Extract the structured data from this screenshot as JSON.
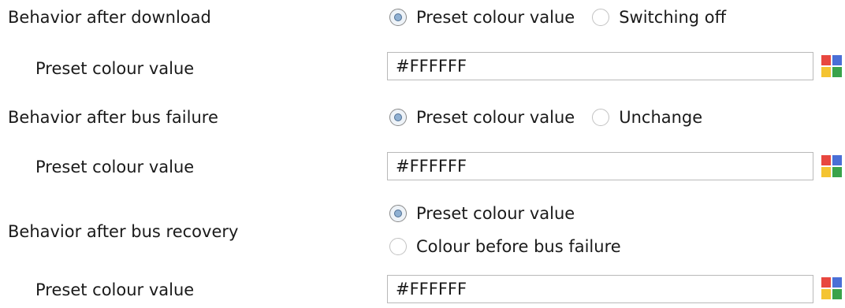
{
  "rows": [
    {
      "label": "Behavior after download",
      "options": [
        {
          "label": "Preset colour value",
          "checked": true
        },
        {
          "label": "Switching off",
          "checked": false
        }
      ]
    },
    {
      "label": "Behavior after bus failure",
      "options": [
        {
          "label": "Preset colour value",
          "checked": true
        },
        {
          "label": "Unchange",
          "checked": false
        }
      ]
    },
    {
      "label": "Behavior after bus recovery",
      "options": [
        {
          "label": "Preset colour value",
          "checked": true
        },
        {
          "label": "Colour before bus failure",
          "checked": false
        }
      ]
    }
  ],
  "colour_fields": [
    {
      "label": "Preset colour value",
      "value": "#FFFFFF"
    },
    {
      "label": "Preset colour value",
      "value": "#FFFFFF"
    },
    {
      "label": "Preset colour value",
      "value": "#FFFFFF"
    }
  ],
  "palette_icon": {
    "icon": "colour-palette-icon",
    "colors": [
      "#e8473f",
      "#4a6fd6",
      "#f4c431",
      "#3aa34a"
    ]
  }
}
